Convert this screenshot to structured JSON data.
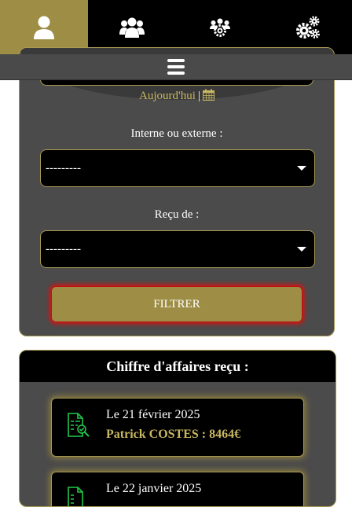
{
  "nav": {
    "tabs": [
      {
        "icon": "user-icon",
        "active": true
      },
      {
        "icon": "users-icon",
        "active": false
      },
      {
        "icon": "users-cog-icon",
        "active": false
      },
      {
        "icon": "cogs-icon",
        "active": false
      }
    ],
    "menu_icon": "hamburger-menu-icon"
  },
  "filter": {
    "today_label": "Aujourd'hui",
    "separator": "|",
    "calendar_icon": "calendar-icon",
    "internal_external_label": "Interne ou externe :",
    "internal_external_value": "---------",
    "received_from_label": "Reçu de :",
    "received_from_value": "---------",
    "filter_button": "FILTRER"
  },
  "revenue": {
    "title": "Chiffre d'affaires reçu :",
    "entries": [
      {
        "date": "Le 21 février 2025",
        "amount": "Patrick COSTES : 8464€",
        "icon": "invoice-check-icon"
      },
      {
        "date": "Le 22 janvier 2025",
        "amount": "",
        "icon": "invoice-check-icon"
      }
    ]
  },
  "colors": {
    "accent": "#9e8e45",
    "gold_text": "#c8b860",
    "icon_green": "#22c94a",
    "alert_red": "#e01010"
  }
}
